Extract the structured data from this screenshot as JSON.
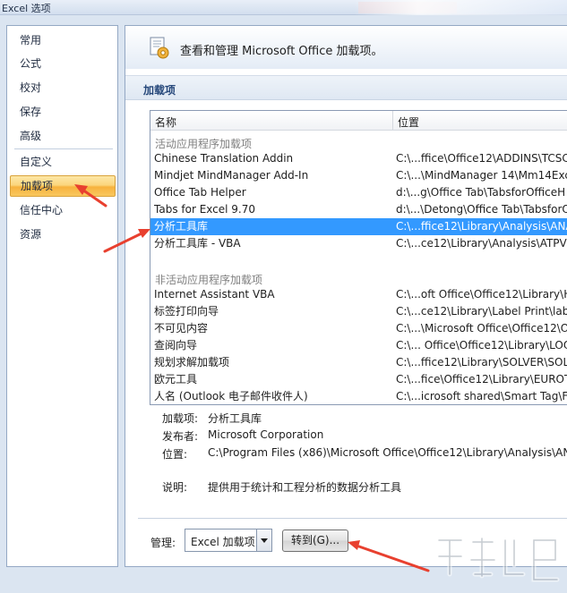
{
  "window": {
    "title": "Excel 选项"
  },
  "sidebar": {
    "items": [
      {
        "label": "常用"
      },
      {
        "label": "公式"
      },
      {
        "label": "校对"
      },
      {
        "label": "保存"
      },
      {
        "label": "高级"
      },
      {
        "label": "自定义"
      },
      {
        "label": "加载项",
        "active": true
      },
      {
        "label": "信任中心"
      },
      {
        "label": "资源"
      }
    ]
  },
  "header": {
    "text": "查看和管理 Microsoft Office 加载项。"
  },
  "section": {
    "title": "加载项"
  },
  "addins_table": {
    "columns": {
      "name": "名称",
      "location": "位置"
    },
    "active_group": {
      "label": "活动应用程序加载项",
      "rows": [
        {
          "name": "Chinese Translation Addin",
          "location": "C:\\...ffice\\Office12\\ADDINS\\TCSC"
        },
        {
          "name": "Mindjet MindManager Add-In",
          "location": "C:\\...\\MindManager 14\\Mm14Exc"
        },
        {
          "name": "Office Tab Helper",
          "location": "d:\\...g\\Office Tab\\TabsforOfficeH"
        },
        {
          "name": "Tabs for Excel 9.70",
          "location": "d:\\...\\Detong\\Office Tab\\TabsforO"
        },
        {
          "name": "分析工具库",
          "location": "C:\\...ffice12\\Library\\Analysis\\ANA",
          "selected": true
        },
        {
          "name": "分析工具库 - VBA",
          "location": "C:\\...ce12\\Library\\Analysis\\ATPVB"
        }
      ]
    },
    "inactive_group": {
      "label": "非活动应用程序加载项",
      "rows": [
        {
          "name": "Internet Assistant VBA",
          "location": "C:\\...oft Office\\Office12\\Library\\H"
        },
        {
          "name": "标签打印向导",
          "location": "C:\\...ce12\\Library\\Label Print\\labe"
        },
        {
          "name": "不可见内容",
          "location": "C:\\...\\Microsoft Office\\Office12\\O"
        },
        {
          "name": "查阅向导",
          "location": "C:\\... Office\\Office12\\Library\\LOO"
        },
        {
          "name": "规划求解加载项",
          "location": "C:\\...ffice12\\Library\\SOLVER\\SOLV"
        },
        {
          "name": "欧元工具",
          "location": "C:\\...fice\\Office12\\Library\\EUROTO"
        },
        {
          "name": "人名 (Outlook 电子邮件收件人)",
          "location": "C:\\...icrosoft shared\\Smart Tag\\FN"
        }
      ]
    }
  },
  "details": {
    "addin_label": "加载项:",
    "addin_value": "分析工具库",
    "publisher_label": "发布者:",
    "publisher_value": "Microsoft Corporation",
    "location_label": "位置:",
    "location_value": "C:\\Program Files (x86)\\Microsoft Office\\Office12\\Library\\Analysis\\ANA",
    "description_label": "说明:",
    "description_value": "提供用于统计和工程分析的数据分析工具"
  },
  "footer": {
    "manage_label": "管理:",
    "manage_selected": "Excel 加载项",
    "go_button": "转到(G)..."
  },
  "colors": {
    "selection": "#3399ff",
    "active_nav": "#fbd67d",
    "arrow": "#e8402f"
  }
}
